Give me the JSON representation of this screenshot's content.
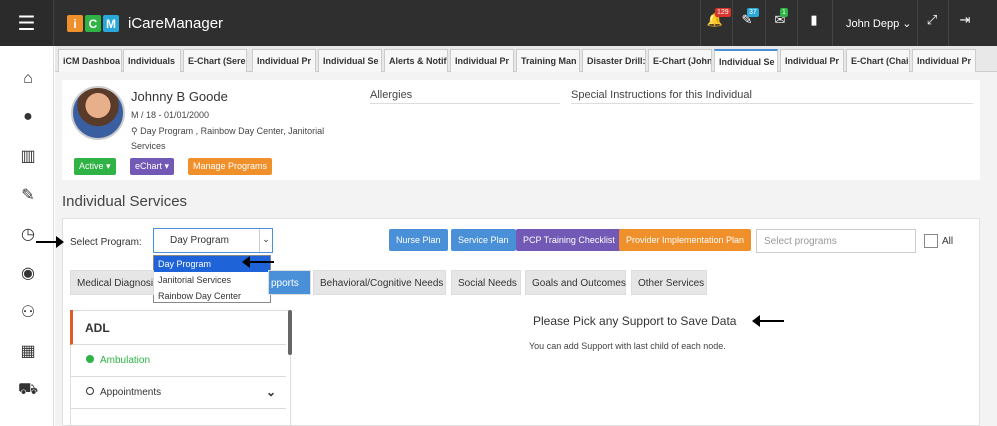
{
  "topbar": {
    "brand": "iCareManager",
    "logo": [
      "i",
      "C",
      "M"
    ],
    "badges": {
      "alerts": "129",
      "tasks": "37",
      "messages": "1"
    },
    "user": "John Depp ⌄"
  },
  "tabs": [
    "iCM Dashboa",
    "Individuals",
    "E-Chart (Sere",
    "Individual Pr",
    "Individual Se",
    "Alerts & Notif",
    "Individual Pr",
    "Training Man",
    "Disaster Drill:",
    "E-Chart (John",
    "Individual Se",
    "Individual Pr",
    "E-Chart (Chai",
    "Individual Pr"
  ],
  "profile": {
    "name": "Johnny B Goode",
    "meta": "M / 18 - 01/01/2000",
    "programs_line1": "Day Program , Rainbow Day Center, Janitorial",
    "programs_line2": "Services",
    "allergies": "Allergies",
    "special": "Special Instructions for this Individual",
    "btn_active": "Active ▾",
    "btn_echart": "eChart ▾",
    "btn_manage": "Manage Programs"
  },
  "section_title": "Individual Services",
  "select": {
    "label": "Select Program:",
    "value": "Day Program",
    "options": [
      "Day Program",
      "Janitorial Services",
      "Rainbow Day Center"
    ]
  },
  "actions": {
    "nurse": "Nurse Plan",
    "service": "Service Plan",
    "pcp": "PCP Training Checklist",
    "provider": "Provider Implementation Plan",
    "search_placeholder": "Select programs",
    "all": "All"
  },
  "subtabs": [
    "Medical Diagnosis",
    "pports",
    "Behavioral/Cognitive Needs",
    "Social Needs",
    "Goals and Outcomes",
    "Other Services"
  ],
  "adl": {
    "title": "ADL",
    "items": [
      "Ambulation",
      "Appointments"
    ]
  },
  "message": "Please Pick any Support to Save Data",
  "submessage": "You can add Support with last child of each node.",
  "colors": {
    "active": "#2fb344",
    "echart": "#7159b5",
    "manage": "#f0902a",
    "nurse": "#4a90d9",
    "pcp": "#7159b5",
    "provider": "#f0902a"
  }
}
